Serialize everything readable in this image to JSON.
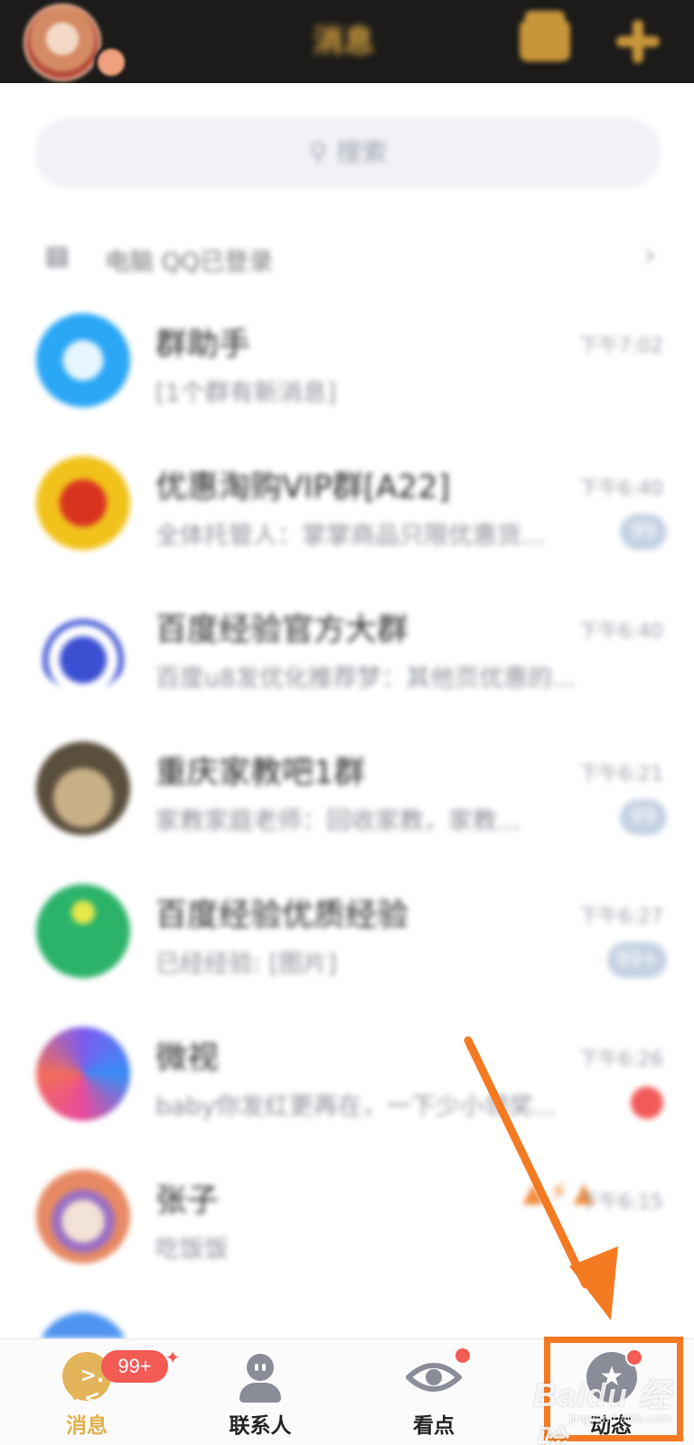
{
  "header": {
    "title": "消息",
    "icons": [
      "video-icon",
      "plus-icon"
    ]
  },
  "search": {
    "placeholder": "搜索"
  },
  "device_row": {
    "label": "电脑 QQ已登录"
  },
  "chats": [
    {
      "name": "群助手",
      "message": "[1个群有新消息]",
      "time": "下午7:02",
      "avatar_color": "#2aa7f5"
    },
    {
      "name": "优惠淘购VIP群[A22]",
      "message": "全体托管人：掌掌商品只限优惠货...",
      "time": "下午6:40",
      "badge": "99",
      "avatar_color": "#e4b21d"
    },
    {
      "name": "百度经验官方大群",
      "message": "百度u8发优化推荐梦：其他页优惠的...",
      "time": "下午6:40",
      "avatar_color": "#3b4fd2"
    },
    {
      "name": "重庆家教吧1群",
      "message": "家教家庭老师：回收家教，家教...",
      "time": "下午6:21",
      "badge": "99",
      "avatar_color": "#8a7a5c"
    },
    {
      "name": "百度经验优质经验",
      "message": "已经经验: [图片]",
      "time": "下午6:27",
      "badge": "99+",
      "avatar_color": "#2cb36a"
    },
    {
      "name": "微视",
      "message": "baby你发红更再在，一下少小领奖...",
      "time": "下午6:26",
      "dot": true,
      "avatar_color": "#7b5cf0"
    },
    {
      "name": "张子",
      "message": "吃饭饭",
      "time": "下午6:15",
      "avatar_color": "#e78a63"
    }
  ],
  "tabs": {
    "messages": {
      "label": "消息",
      "badge": "99+"
    },
    "contacts": {
      "label": "联系人"
    },
    "discover": {
      "label": "看点"
    },
    "moments": {
      "label": "动态"
    }
  },
  "colors": {
    "accent": "#e0b04a",
    "highlight": "#f47a22",
    "badge": "#f35b55"
  },
  "watermark": {
    "main": "Baidu 经验",
    "sub": "jingyan.baidu.com"
  }
}
